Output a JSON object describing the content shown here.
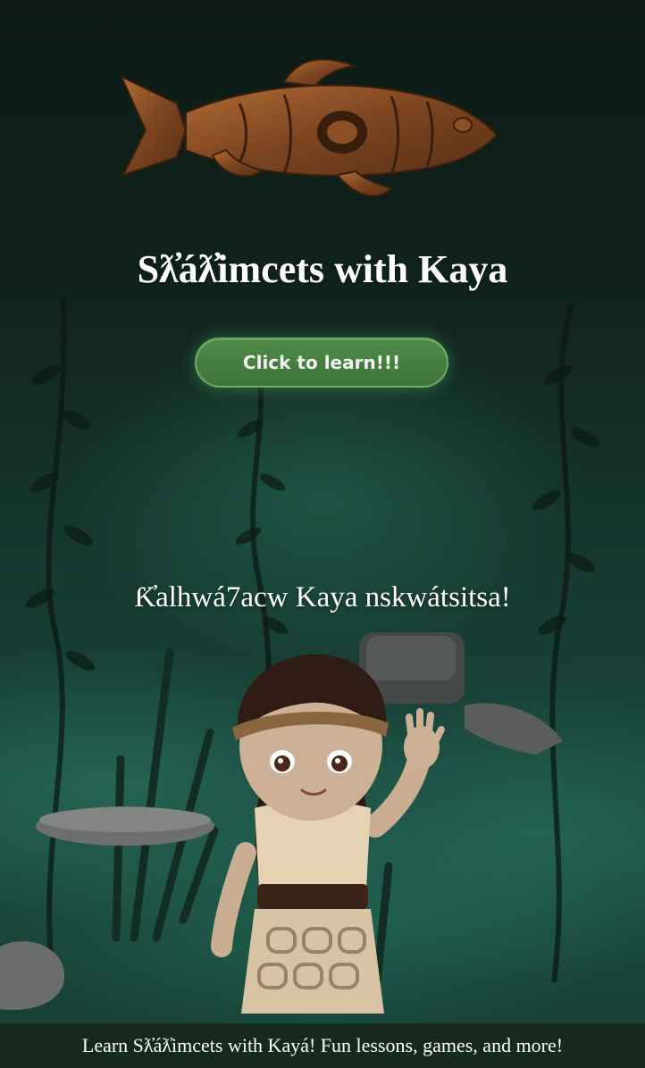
{
  "app": {
    "title": "Sƛ̓áƛ̓imcets with Kaya"
  },
  "hero": {
    "button_label": "Click to learn!!!",
    "greeting": "Ƙ̓alhwá7acw Kaya nskwátsitsa!"
  },
  "footer": {
    "text": "Learn Sƛ̓áƛ̓imcets with Kayá! Fun lessons, games, and more!"
  },
  "colors": {
    "background": "#10221c",
    "button": "#3e7439",
    "footer": "#16291f",
    "text": "#ffffff"
  },
  "icons": {
    "logo": "salmon-carving-logo",
    "character": "kaya-character"
  }
}
